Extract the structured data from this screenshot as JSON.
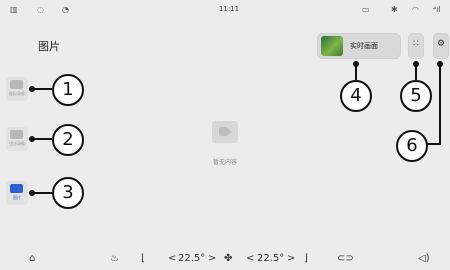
{
  "status_bar": {
    "time": "11:11",
    "left_icons": [
      "app-icon",
      "message-icon",
      "clock-icon"
    ],
    "right_icons": [
      "camera-icon",
      "bluetooth-icon",
      "wifi-icon",
      "signal-icon"
    ]
  },
  "page": {
    "title": "图片",
    "live_view_label": "实时画面",
    "empty_text": "暂无内容"
  },
  "sidebar": {
    "items": [
      {
        "label": "疑似录像",
        "icon": "video-icon"
      },
      {
        "label": "违法录像",
        "icon": "video-icon"
      },
      {
        "label": "图片",
        "icon": "image-icon"
      }
    ]
  },
  "callouts": {
    "c1": "1",
    "c2": "2",
    "c3": "3",
    "c4": "4",
    "c5": "5",
    "c6": "6"
  },
  "bottom_bar": {
    "left_temp": "22.5°",
    "right_temp": "22.5°",
    "left_prev": "<",
    "left_next": ">",
    "right_prev": "<",
    "right_next": ">"
  }
}
